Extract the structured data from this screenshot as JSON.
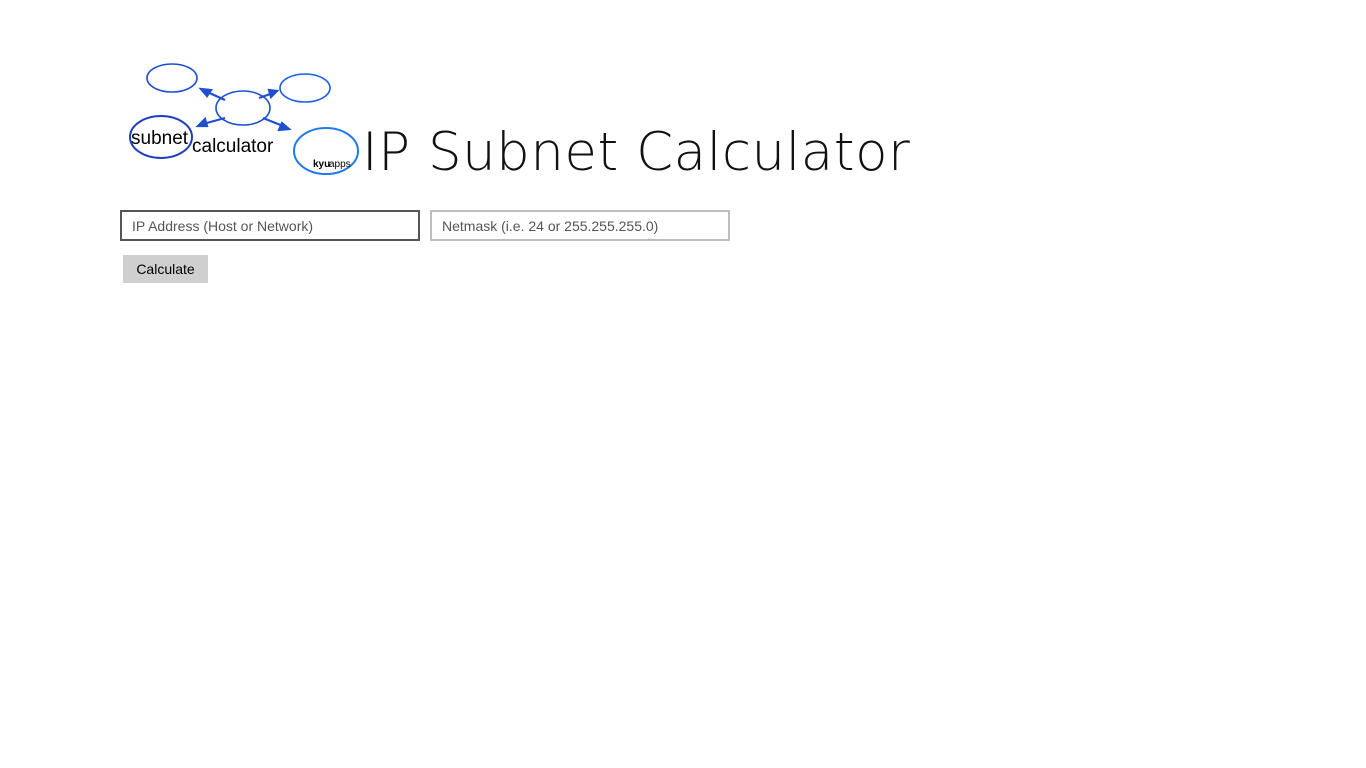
{
  "app": {
    "title": "IP Subnet Calculator"
  },
  "logo": {
    "word_subnet": "subnet",
    "word_calculator": "calculator",
    "brand_kyu": "kyu",
    "brand_apps": "apps",
    "icon": "subnet-network-diagram-icon",
    "accent_color": "#1f4fcf"
  },
  "form": {
    "ip_field": {
      "value": "",
      "placeholder": "IP Address (Host or Network)"
    },
    "netmask_field": {
      "value": "",
      "placeholder": "Netmask (i.e. 24 or 255.255.255.0)"
    },
    "calculate_label": "Calculate"
  }
}
